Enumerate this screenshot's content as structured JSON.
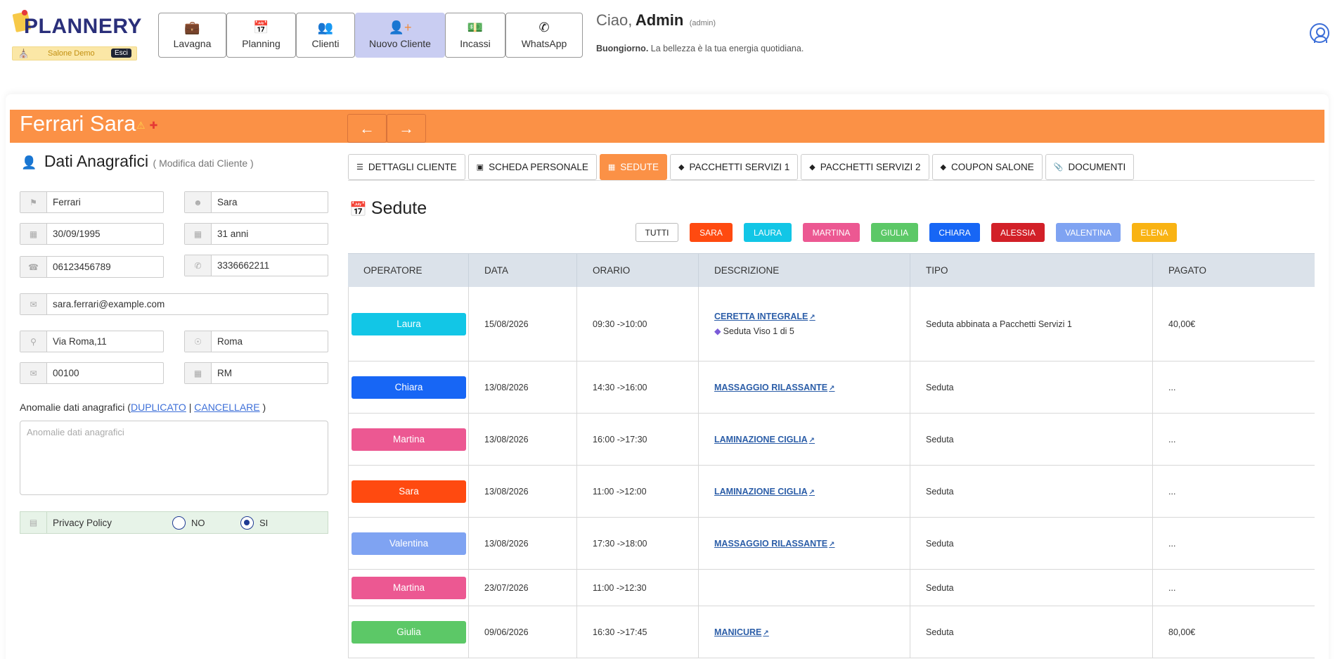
{
  "brand": {
    "name": "PLANNERY",
    "salone": "Salone Demo",
    "esci": "Esci"
  },
  "nav": [
    {
      "label": "Lavagna",
      "icon": "briefcase-icon"
    },
    {
      "label": "Planning",
      "icon": "calendar-icon"
    },
    {
      "label": "Clienti",
      "icon": "users-icon"
    },
    {
      "label": "Nuovo Cliente",
      "icon": "user-plus-icon"
    },
    {
      "label": "Incassi",
      "icon": "cash-icon"
    },
    {
      "label": "WhatsApp",
      "icon": "whatsapp-icon"
    }
  ],
  "greeting": {
    "hello": "Ciao,",
    "name": "Admin",
    "role": "(admin)",
    "sub_bold": "Buongiorno.",
    "sub_text": "La bellezza è la tua energia quotidiana."
  },
  "client": {
    "name": "Ferrari Sara"
  },
  "anagrafica": {
    "title": "Dati Anagrafici",
    "subtitle": "( Modifica dati Cliente )",
    "cognome": "Ferrari",
    "nome": "Sara",
    "data_nascita": "30/09/1995",
    "eta": "31 anni",
    "telefono": "06123456789",
    "cellulare": "3336662211",
    "email": "sara.ferrari@example.com",
    "indirizzo": "Via Roma,11",
    "citta": "Roma",
    "cap": "00100",
    "provincia": "RM",
    "anomalie_label": "Anomalie dati anagrafici (",
    "duplicato": "DUPLICATO",
    "separator": "|",
    "cancellare": "CANCELLARE",
    "close_paren": ")",
    "anomalie_placeholder": "Anomalie dati anagrafici",
    "privacy_label": "Privacy Policy",
    "privacy_no": "NO",
    "privacy_si": "SI"
  },
  "tabs": [
    {
      "label": "DETTAGLI CLIENTE",
      "active": false
    },
    {
      "label": "SCHEDA PERSONALE",
      "active": false
    },
    {
      "label": "SEDUTE",
      "active": true
    },
    {
      "label": "PACCHETTI SERVIZI 1",
      "active": false
    },
    {
      "label": "PACCHETTI SERVIZI 2",
      "active": false
    },
    {
      "label": "COUPON SALONE",
      "active": false
    },
    {
      "label": "DOCUMENTI",
      "active": false
    }
  ],
  "sedute": {
    "title": "Sedute",
    "filters": [
      {
        "label": "TUTTI",
        "color": "#ffffff"
      },
      {
        "label": "SARA",
        "color": "#ff4a10"
      },
      {
        "label": "LAURA",
        "color": "#12c6e6"
      },
      {
        "label": "MARTINA",
        "color": "#ec5892"
      },
      {
        "label": "GIULIA",
        "color": "#5cc867"
      },
      {
        "label": "CHIARA",
        "color": "#1766f5"
      },
      {
        "label": "ALESSIA",
        "color": "#d22028"
      },
      {
        "label": "VALENTINA",
        "color": "#7fa3f2"
      },
      {
        "label": "ELENA",
        "color": "#f9b313"
      }
    ],
    "columns": [
      "OPERATORE",
      "DATA",
      "ORARIO",
      "DESCRIZIONE",
      "TIPO",
      "PAGATO"
    ],
    "rows": [
      {
        "operatore": "Laura",
        "color": "#12c6e6",
        "data": "15/08/2026",
        "orario": "09:30 ->10:00",
        "descrizione": "CERETTA INTEGRALE",
        "sub": "Seduta Viso 1 di 5",
        "tipo": "Seduta abbinata a Pacchetti Servizi 1",
        "pagato": "40,00€"
      },
      {
        "operatore": "Chiara",
        "color": "#1766f5",
        "data": "13/08/2026",
        "orario": "14:30 ->16:00",
        "descrizione": "MASSAGGIO RILASSANTE",
        "sub": "",
        "tipo": "Seduta",
        "pagato": "..."
      },
      {
        "operatore": "Martina",
        "color": "#ec5892",
        "data": "13/08/2026",
        "orario": "16:00 ->17:30",
        "descrizione": "LAMINAZIONE CIGLIA",
        "sub": "",
        "tipo": "Seduta",
        "pagato": "..."
      },
      {
        "operatore": "Sara",
        "color": "#ff4a10",
        "data": "13/08/2026",
        "orario": "11:00 ->12:00",
        "descrizione": "LAMINAZIONE CIGLIA",
        "sub": "",
        "tipo": "Seduta",
        "pagato": "..."
      },
      {
        "operatore": "Valentina",
        "color": "#7fa3f2",
        "data": "13/08/2026",
        "orario": "17:30 ->18:00",
        "descrizione": "MASSAGGIO RILASSANTE",
        "sub": "",
        "tipo": "Seduta",
        "pagato": "..."
      },
      {
        "operatore": "Martina",
        "color": "#ec5892",
        "data": "23/07/2026",
        "orario": "11:00 ->12:30",
        "descrizione": "",
        "sub": "",
        "tipo": "Seduta",
        "pagato": "..."
      },
      {
        "operatore": "Giulia",
        "color": "#5cc867",
        "data": "09/06/2026",
        "orario": "16:30 ->17:45",
        "descrizione": "MANICURE",
        "sub": "",
        "tipo": "Seduta",
        "pagato": "80,00€"
      }
    ]
  }
}
